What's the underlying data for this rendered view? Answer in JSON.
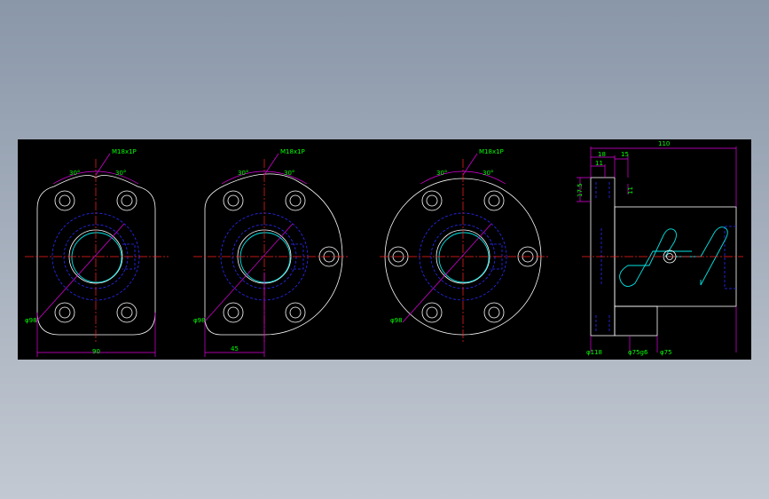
{
  "drawing": {
    "views": [
      {
        "id": "view-1",
        "thread_callout": "M18x1P",
        "angle_left": "30°",
        "angle_right": "30°",
        "pcd": "φ98",
        "width_dim": "90"
      },
      {
        "id": "view-2",
        "thread_callout": "M18x1P",
        "angle_left": "30°",
        "angle_right": "30°",
        "pcd": "φ98",
        "offset_dim": "45"
      },
      {
        "id": "view-3",
        "thread_callout": "M18x1P",
        "angle_left": "30°",
        "angle_right": "30°",
        "pcd": "φ98"
      }
    ],
    "side_view": {
      "overall_length": "110",
      "flange_thickness": "18",
      "step_length": "15",
      "small_dim": "11",
      "hole_offset": "17.5",
      "hole_depth": "11",
      "flange_dia": "φ118",
      "fit_dia": "φ75g6",
      "body_dia": "φ75"
    }
  },
  "colors": {
    "background": "#000000",
    "outline": "#ffffff",
    "hidden": "#2a2aff",
    "center": "#ff2020",
    "dimension": "#e000e0",
    "text": "#00ff00",
    "highlight": "#00e5e5"
  }
}
